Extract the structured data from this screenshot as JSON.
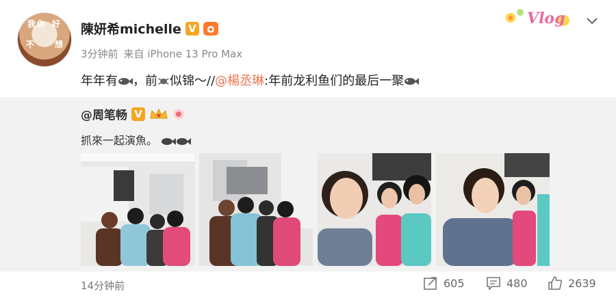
{
  "post": {
    "author": "陳妍希michelle",
    "avatar_text": [
      "我",
      "你",
      "好",
      "不",
      "想"
    ],
    "time": "3分钟前",
    "source": "来自 iPhone 13 Pro Max",
    "vlog_label": "Vlog",
    "content_before": "年年有",
    "content_mid1": "，前",
    "content_mid2": "似锦～//",
    "mention": "@楊丞琳",
    "content_after": ":年前龙利鱼们的最后一聚"
  },
  "repost": {
    "author": "@周笔畅",
    "text": "抓來一起演魚。",
    "photos": [
      "group-photo-1",
      "group-photo-2",
      "selfie-photo-3",
      "selfie-photo-4"
    ]
  },
  "footer": {
    "time": "14分钟前",
    "shares": "605",
    "comments": "480",
    "likes": "2639"
  },
  "colors": {
    "mention": "#eb7350",
    "v_badge": "#f5a623",
    "repost_bg": "#f2f2f2"
  },
  "icons": [
    "chevron-down-icon",
    "share-icon",
    "comment-icon",
    "like-icon",
    "fish-emoji-icon"
  ]
}
